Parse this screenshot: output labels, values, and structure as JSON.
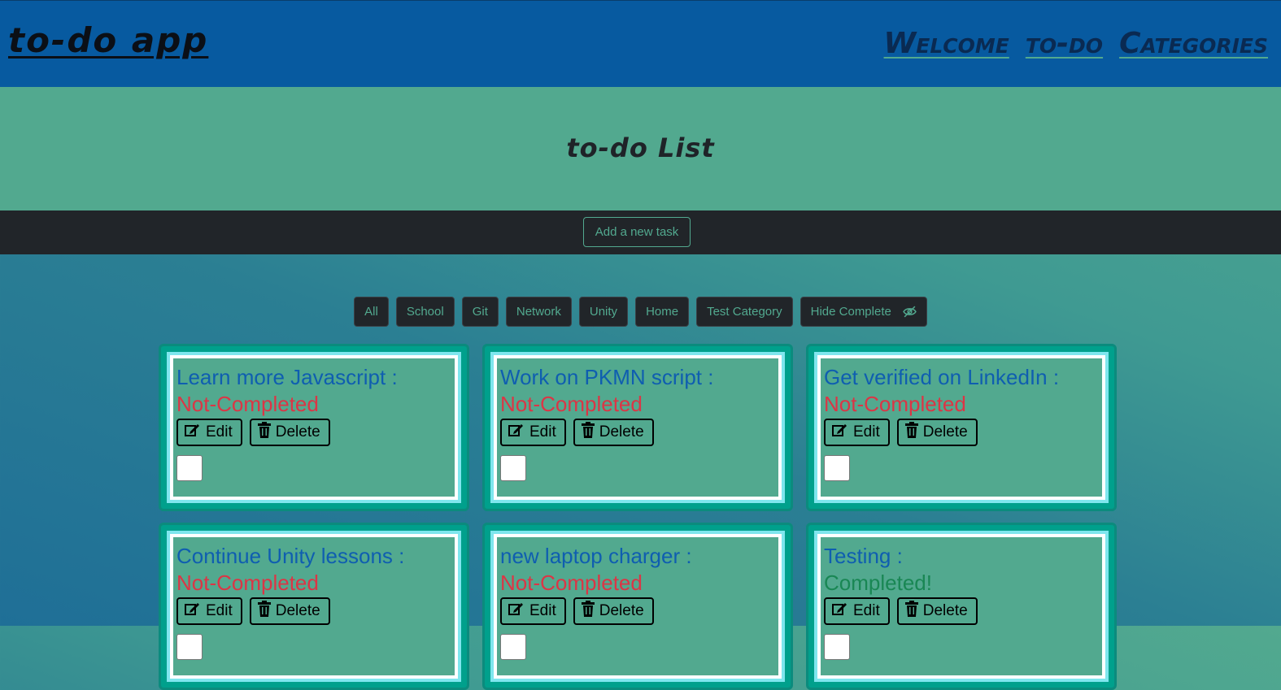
{
  "navbar": {
    "brand": "to-do app",
    "links": [
      "Welcome",
      "to-do",
      "Categories"
    ]
  },
  "hero": {
    "title": "to-do List"
  },
  "add_task": {
    "label": "Add a new task"
  },
  "filters": [
    "All",
    "School",
    "Git",
    "Network",
    "Unity",
    "Home",
    "Test Category"
  ],
  "hide_complete": {
    "label": "Hide Complete",
    "icon": "eye-slash-icon"
  },
  "card_actions": {
    "edit_label": "Edit",
    "delete_label": "Delete"
  },
  "tasks": [
    {
      "title": "Learn more Javascript :",
      "status": "Not-Completed",
      "completed": false
    },
    {
      "title": "Work on PKMN script :",
      "status": "Not-Completed",
      "completed": false
    },
    {
      "title": "Get verified on LinkedIn :",
      "status": "Not-Completed",
      "completed": false
    },
    {
      "title": "Continue Unity lessons :",
      "status": "Not-Completed",
      "completed": false
    },
    {
      "title": "new laptop charger :",
      "status": "Not-Completed",
      "completed": false
    },
    {
      "title": "Testing :",
      "status": "Completed!",
      "completed": true
    }
  ],
  "colors": {
    "navbar": "#075aa0",
    "accent": "#52a98f",
    "not_completed": "#dc3545",
    "completed": "#198754"
  }
}
